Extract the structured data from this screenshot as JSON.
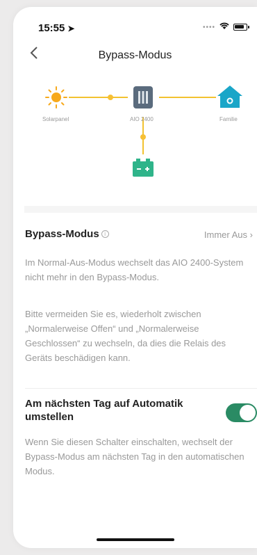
{
  "status_bar": {
    "time": "15:55"
  },
  "nav": {
    "back_icon": "chevron-left-icon",
    "title": "Bypass-Modus"
  },
  "diagram": {
    "solar_label": "Solarpanel",
    "aio_label": "AIO 2400",
    "family_label": "Familie"
  },
  "bypass": {
    "title": "Bypass-Modus",
    "value": "Immer Aus",
    "para1": "Im Normal-Aus-Modus wechselt das AIO 2400-System nicht mehr in den Bypass-Modus.",
    "para2": "Bitte vermeiden Sie es, wiederholt zwischen „Normalerweise Offen“ und „Normalerweise Geschlossen“ zu wechseln, da dies die Relais des Geräts beschädigen kann."
  },
  "auto": {
    "title": "Am nächsten Tag auf Automatik umstellen",
    "enabled": true,
    "description": "Wenn Sie diesen Schalter einschalten, wechselt der Bypass-Modus am nächsten Tag in den automatischen Modus."
  },
  "colors": {
    "accent": "#2a8b64",
    "flow": "#f2c230",
    "sun": "#f7a91c",
    "house": "#1aa6c8"
  }
}
